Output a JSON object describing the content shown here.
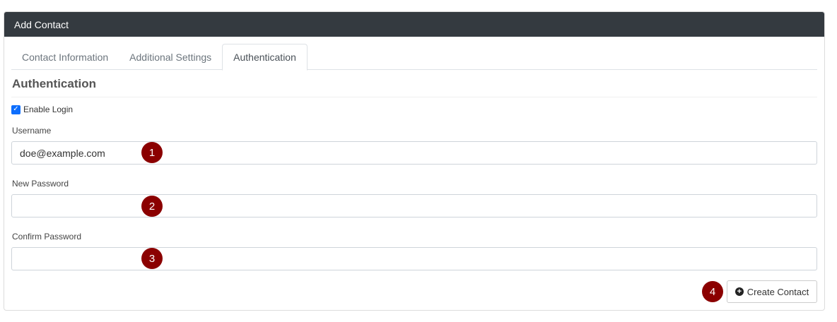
{
  "panel": {
    "title": "Add Contact"
  },
  "tabs": [
    {
      "label": "Contact Information",
      "active": false
    },
    {
      "label": "Additional Settings",
      "active": false
    },
    {
      "label": "Authentication",
      "active": true
    }
  ],
  "section": {
    "title": "Authentication"
  },
  "enable_login": {
    "label": "Enable Login",
    "checked": true
  },
  "fields": {
    "username": {
      "label": "Username",
      "value": "doe@example.com"
    },
    "new_password": {
      "label": "New Password",
      "value": ""
    },
    "confirm_password": {
      "label": "Confirm Password",
      "value": ""
    }
  },
  "badges": [
    "1",
    "2",
    "3",
    "4"
  ],
  "actions": {
    "create_label": "Create Contact",
    "create_icon": "plus-circle-icon"
  },
  "colors": {
    "header_bg": "#343a40",
    "badge_bg": "#8b0000",
    "checkbox": "#0d6efd"
  }
}
